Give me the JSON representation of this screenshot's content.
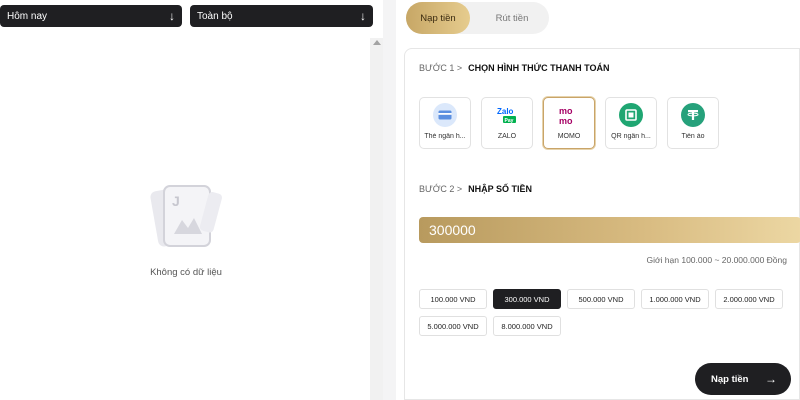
{
  "filters": {
    "date": {
      "label": "Hôm nay",
      "icon": "arrow-down-icon"
    },
    "type": {
      "label": "Toàn bộ",
      "icon": "arrow-down-icon"
    }
  },
  "history": {
    "empty_text": "Không có dữ liệu",
    "empty_icon": "empty-card-icon"
  },
  "tabs": {
    "deposit": "Nạp tiền",
    "withdraw": "Rút tiền",
    "active": "deposit"
  },
  "step1": {
    "number": "BƯỚC 1 >",
    "title": "CHỌN HÌNH THỨC THANH TOÁN"
  },
  "methods": [
    {
      "label": "Thẻ ngân h...",
      "icon": "bank-card-icon"
    },
    {
      "label": "ZALO",
      "icon": "zalopay-icon"
    },
    {
      "label": "MOMO",
      "icon": "momo-icon",
      "selected": true
    },
    {
      "label": "QR ngân h...",
      "icon": "qr-bank-icon"
    },
    {
      "label": "Tiền ảo",
      "icon": "tether-icon"
    }
  ],
  "step2": {
    "number": "BƯỚC 2 >",
    "title": "NHẬP SỐ TIỀN"
  },
  "amount": {
    "value": "300000"
  },
  "limit_text": "Giới hạn 100.000 ~ 20.000.000 Đồng",
  "amount_options": [
    "100.000 VND",
    "300.000 VND",
    "500.000 VND",
    "1.000.000 VND",
    "2.000.000 VND",
    "5.000.000 VND",
    "8.000.000 VND"
  ],
  "selected_amount": "300.000 VND",
  "submit": {
    "label": "Nạp tiền",
    "icon": "arrow-right-icon"
  },
  "colors": {
    "dark": "#1f1f22",
    "gold": "#c9a468",
    "momo": "#a50064",
    "zalo": "#0068ff",
    "qr": "#1fa672",
    "tether": "#26a17b"
  }
}
